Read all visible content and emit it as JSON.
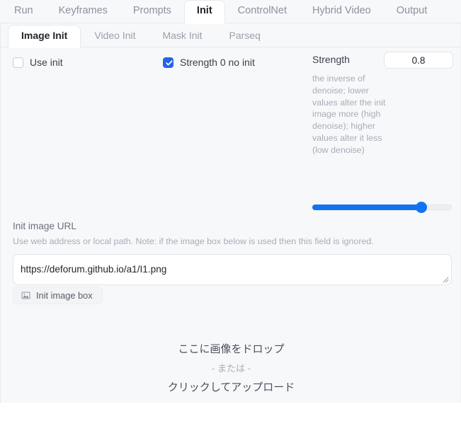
{
  "top_tabs": [
    {
      "label": "Run",
      "active": false
    },
    {
      "label": "Keyframes",
      "active": false
    },
    {
      "label": "Prompts",
      "active": false
    },
    {
      "label": "Init",
      "active": true
    },
    {
      "label": "ControlNet",
      "active": false
    },
    {
      "label": "Hybrid Video",
      "active": false
    },
    {
      "label": "Output",
      "active": false
    }
  ],
  "sub_tabs": [
    {
      "label": "Image Init",
      "active": true
    },
    {
      "label": "Video Init",
      "active": false
    },
    {
      "label": "Mask Init",
      "active": false
    },
    {
      "label": "Parseq",
      "active": false
    }
  ],
  "checkboxes": [
    {
      "label": "Use init",
      "checked": false
    },
    {
      "label": "Strength 0 no init",
      "checked": true
    }
  ],
  "strength": {
    "label": "Strength",
    "value": "0.8",
    "description": "the inverse of denoise; lower values alter the init image more (high denoise); higher values alter it less (low denoise)",
    "slider_percent": 78
  },
  "init_image_url": {
    "title": "Init image URL",
    "help": "Use web address or local path. Note: if the image box below is used then this field is ignored.",
    "value": "https://deforum.github.io/a1/I1.png",
    "placeholder": ""
  },
  "init_image_box_button": {
    "label": "Init image box",
    "icon": "image-icon"
  },
  "dropzone": {
    "line1": "ここに画像をドロップ",
    "line2": "- または -",
    "line3": "クリックしてアップロード"
  },
  "colors": {
    "accent": "#1272f0",
    "checkbox_checked": "#2563eb",
    "panel_bg": "#f7f8fa",
    "tab_active_bg": "#ffffff",
    "muted_text": "#a8adb8"
  }
}
